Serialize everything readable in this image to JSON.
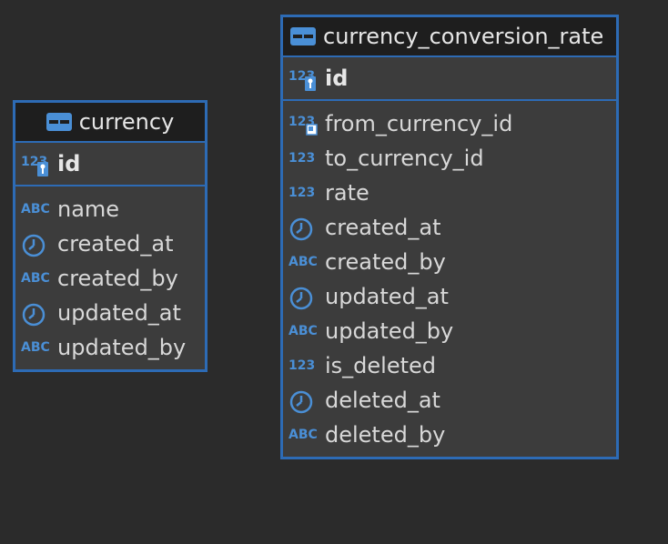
{
  "entities": {
    "currency": {
      "title": "currency",
      "pk": "id",
      "columns": [
        {
          "name": "name",
          "type": "text"
        },
        {
          "name": "created_at",
          "type": "datetime"
        },
        {
          "name": "created_by",
          "type": "text"
        },
        {
          "name": "updated_at",
          "type": "datetime"
        },
        {
          "name": "updated_by",
          "type": "text"
        }
      ]
    },
    "currency_conversion_rate": {
      "title": "currency_conversion_rate",
      "pk": "id",
      "columns": [
        {
          "name": "from_currency_id",
          "type": "number-fk"
        },
        {
          "name": "to_currency_id",
          "type": "number"
        },
        {
          "name": "rate",
          "type": "number"
        },
        {
          "name": "created_at",
          "type": "datetime"
        },
        {
          "name": "created_by",
          "type": "text"
        },
        {
          "name": "updated_at",
          "type": "datetime"
        },
        {
          "name": "updated_by",
          "type": "text"
        },
        {
          "name": "is_deleted",
          "type": "number"
        },
        {
          "name": "deleted_at",
          "type": "datetime"
        },
        {
          "name": "deleted_by",
          "type": "text"
        }
      ]
    }
  },
  "icons": {
    "number_glyph": "123",
    "text_glyph": "ABC"
  },
  "colors": {
    "accent": "#2d6bb5",
    "icon_blue": "#4a8fd6",
    "background": "#2b2b2b",
    "entity_bg": "#3c3c3c",
    "header_bg": "#1e1e1e",
    "text": "#d8d8d8"
  }
}
